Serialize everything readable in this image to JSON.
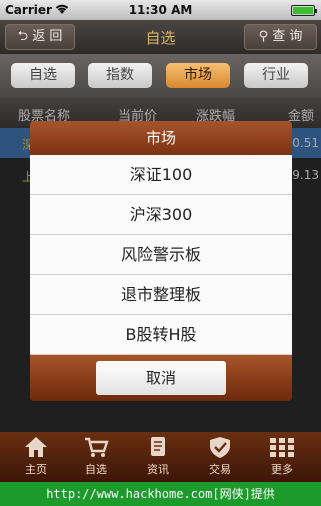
{
  "status": {
    "carrier": "Carrier",
    "time": "11:30 AM"
  },
  "navbar": {
    "back_label": "返 回",
    "title": "自选",
    "search_label": "查 询"
  },
  "segments": [
    {
      "label": "自选"
    },
    {
      "label": "指数"
    },
    {
      "label": "市场",
      "active": true
    },
    {
      "label": "行业"
    }
  ],
  "table": {
    "headers": [
      "股票名称",
      "当前价",
      "涨跌幅",
      "金额"
    ],
    "rows": [
      {
        "name": "深",
        "amount": "0.51"
      },
      {
        "name": "上",
        "amount": "9.13"
      }
    ]
  },
  "dialog": {
    "title": "市场",
    "options": [
      "深证100",
      "沪深300",
      "风险警示板",
      "退市整理板",
      "B股转H股"
    ],
    "cancel_label": "取消"
  },
  "tabbar": {
    "items": [
      {
        "label": "主页",
        "icon": "home-icon"
      },
      {
        "label": "自选",
        "icon": "cart-icon"
      },
      {
        "label": "资讯",
        "icon": "scroll-icon"
      },
      {
        "label": "交易",
        "icon": "shield-icon"
      },
      {
        "label": "更多",
        "icon": "grid-icon"
      }
    ]
  },
  "watermark": "http://www.hackhome.com[网侠]提供",
  "colors": {
    "accent": "#d9882e",
    "brand": "#6b2f12",
    "title": "#d9b45f"
  }
}
